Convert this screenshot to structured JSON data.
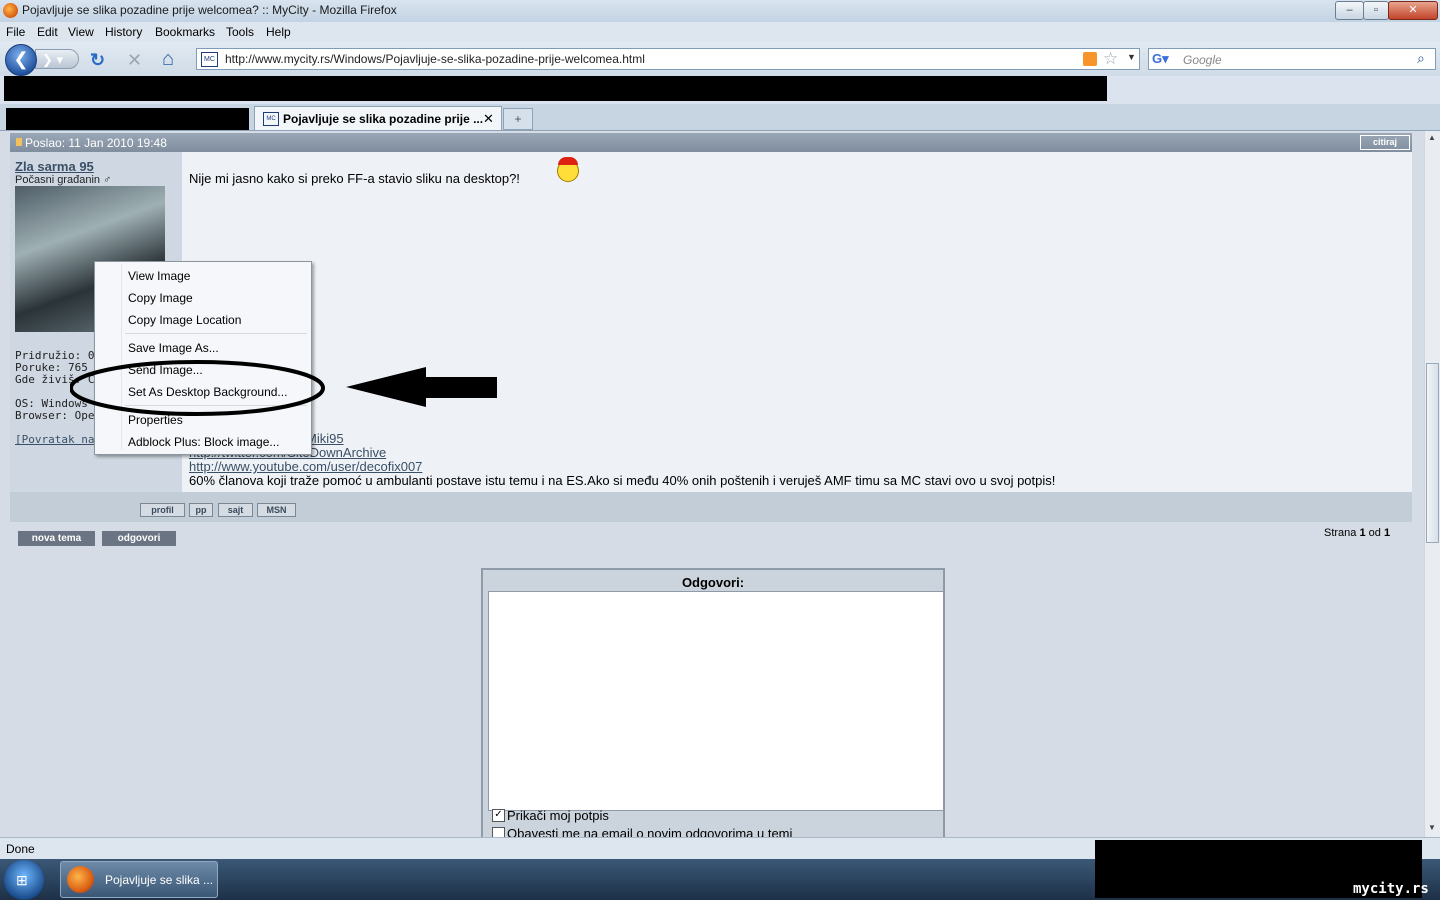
{
  "window": {
    "title": "Pojavljuje se slika pozadine prije welcomea? :: MyCity - Mozilla Firefox",
    "controls": {
      "minimize": "–",
      "maximize": "▫",
      "close": "✕"
    }
  },
  "menubar": [
    "File",
    "Edit",
    "View",
    "History",
    "Bookmarks",
    "Tools",
    "Help"
  ],
  "navbar": {
    "url": "http://www.mycity.rs/Windows/Pojavljuje-se-slika-pozadine-prije-welcomea.html",
    "site_icon": "MC",
    "search_placeholder": "Google",
    "back_glyph": "❮",
    "forward_glyph": "❯ ▾",
    "reload_glyph": "↻",
    "stop_glyph": "✕",
    "home_glyph": "⌂"
  },
  "tabs": {
    "active_label": "Pojavljuje se slika pozadine prije ...",
    "close_glyph": "✕",
    "new_tab_glyph": "+"
  },
  "post": {
    "header": "Poslao: 11 Jan 2010 19:48",
    "quote_button": "citiraj",
    "author": "Zla sarma 95",
    "rank": "Počasni građanin ♂",
    "info": [
      "Pridružio: 02 J",
      "Poruke: 765",
      "Gde živiš: Či",
      "",
      "OS: Windows",
      "Browser: Oper"
    ],
    "back_link": "[Povratak na v",
    "message": "Nije mi jasno kako si preko FF-a stavio sliku na desktop?!",
    "sig_links": [
      "Miki95",
      "http://twitter.com/SiteDownArchive",
      "http://www.youtube.com/user/decofix007"
    ],
    "signature": "60% članova koji traže pomoć u ambulanti postave istu temu i na ES.Ako si među 40% onih poštenih i veruješ AMF timu sa MC stavi ovo u svoj potpis!",
    "footer_buttons": [
      "profil",
      "pp",
      "sajt",
      "MSN"
    ]
  },
  "actions": {
    "new_topic": "nova tema",
    "reply": "odgovori"
  },
  "pagination": {
    "prefix": "Strana ",
    "current": "1",
    "middle": " od ",
    "total": "1"
  },
  "reply_form": {
    "title": "Odgovori:",
    "checkbox_signature": "Prikači moj potpis",
    "checkbox_signature_checked": true,
    "checkbox_notify": "Obavesti me na email o novim odgovorima u temi"
  },
  "context_menu": [
    "View Image",
    "Copy Image",
    "Copy Image Location",
    "Save Image As...",
    "Send Image...",
    "Set As Desktop Background...",
    "Properties",
    "Adblock Plus: Block image..."
  ],
  "status": "Done",
  "taskbar": {
    "item": "Pojavljuje se slika ...",
    "start_glyph": "⊞"
  },
  "watermark": "mycity.rs"
}
